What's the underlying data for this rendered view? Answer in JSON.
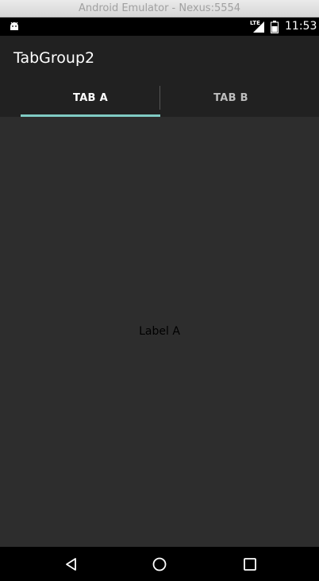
{
  "window": {
    "title": "Android Emulator - Nexus:5554"
  },
  "statusbar": {
    "network": "LTE",
    "time": "11:53",
    "icons": [
      "android-debug-icon",
      "signal-icon",
      "battery-icon"
    ]
  },
  "appbar": {
    "title": "TabGroup2"
  },
  "tabs": [
    {
      "label": "TAB A",
      "selected": true
    },
    {
      "label": "TAB B",
      "selected": false
    }
  ],
  "content": {
    "label": "Label A"
  },
  "navbar": {
    "buttons": [
      "back-icon",
      "home-icon",
      "recents-icon"
    ]
  },
  "colors": {
    "accent": "#80cbc4",
    "appbar": "#212121",
    "background": "#2d2d2d"
  }
}
